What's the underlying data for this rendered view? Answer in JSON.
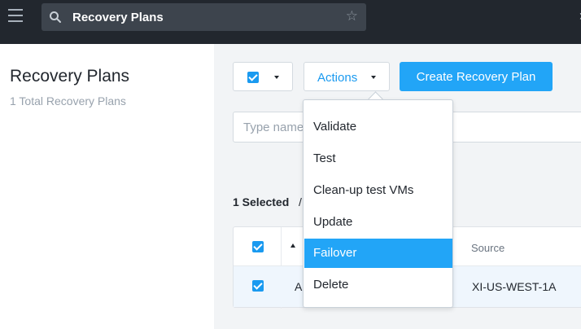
{
  "header": {
    "search_value": "Recovery Plans",
    "icons": [
      "menu-icon",
      "search-icon",
      "star-icon",
      "corner-icon"
    ],
    "corner_glyph": "›"
  },
  "sidebar": {
    "title": "Recovery Plans",
    "subtitle": "1 Total Recovery Plans"
  },
  "toolbar": {
    "actions_label": "Actions",
    "create_label": "Create Recovery Plan"
  },
  "filter": {
    "placeholder": "Type name"
  },
  "selection": {
    "count_text": "1 Selected",
    "separator": "/"
  },
  "table": {
    "columns": [
      "",
      "",
      "Source"
    ],
    "rows": [
      {
        "name": "A",
        "source": "XI-US-WEST-1A",
        "selected": true
      }
    ]
  },
  "actions_menu": {
    "items": [
      "Validate",
      "Test",
      "Clean-up test VMs",
      "Update",
      "Failover",
      "Delete"
    ],
    "highlighted": "Failover"
  },
  "colors": {
    "accent": "#22a5f7",
    "topbar": "#22272e"
  }
}
